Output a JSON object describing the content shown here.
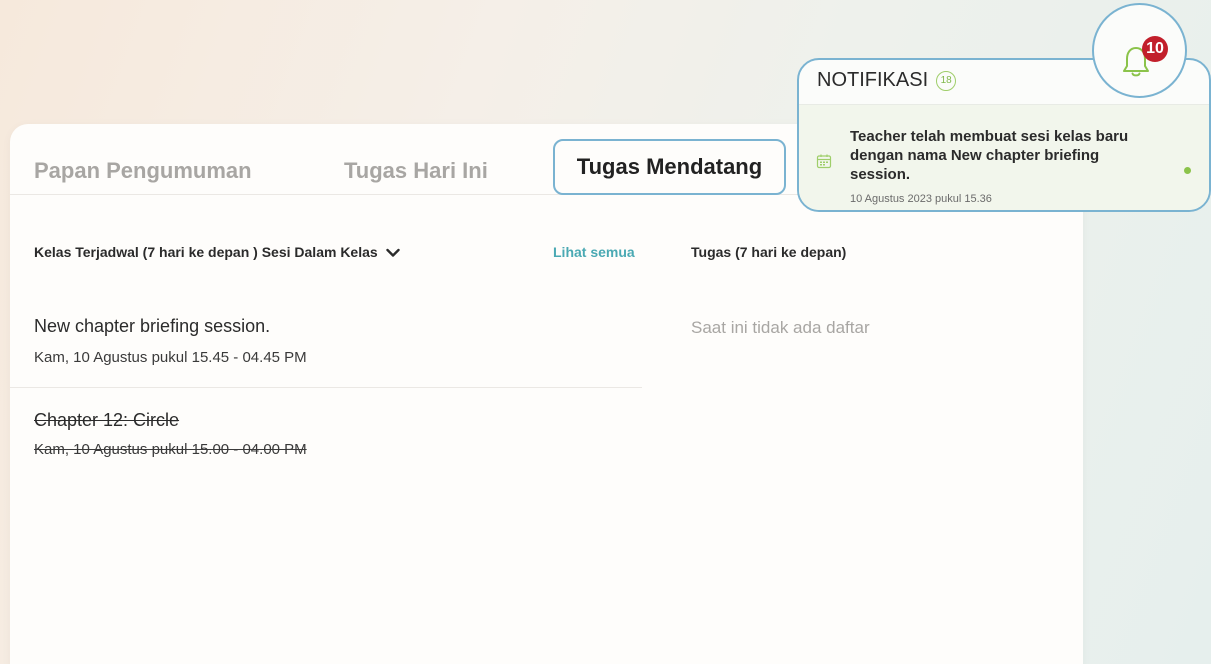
{
  "tabs": {
    "announcements": "Papan Pengumuman",
    "today": "Tugas Hari Ini",
    "upcoming": "Tugas Mendatang"
  },
  "scheduled": {
    "title": "Kelas Terjadwal (7 hari ke depan )",
    "dropdown": "Sesi Dalam Kelas",
    "see_all": "Lihat semua",
    "sessions": [
      {
        "title": "New chapter briefing session.",
        "time": "Kam, 10 Agustus pukul 15.45 - 04.45 PM",
        "cancelled": false
      },
      {
        "title": "Chapter 12: Circle",
        "time": "Kam, 10 Agustus pukul 15.00 - 04.00 PM",
        "cancelled": true
      }
    ]
  },
  "tasks": {
    "title": "Tugas (7 hari ke depan)",
    "empty": "Saat ini tidak ada daftar"
  },
  "notifications": {
    "header": "NOTIFIKASI",
    "count": "18",
    "bell_badge": "10",
    "items": [
      {
        "text": "Teacher telah membuat sesi kelas baru dengan nama New chapter briefing session.",
        "time": "10 Agustus 2023 pukul 15.36",
        "icon": "calendar-icon",
        "unread": true
      }
    ]
  },
  "colors": {
    "accent_border": "#7ab3d1",
    "link": "#4aa9b3",
    "badge": "#c21f2b",
    "bell": "#8bc34a"
  }
}
